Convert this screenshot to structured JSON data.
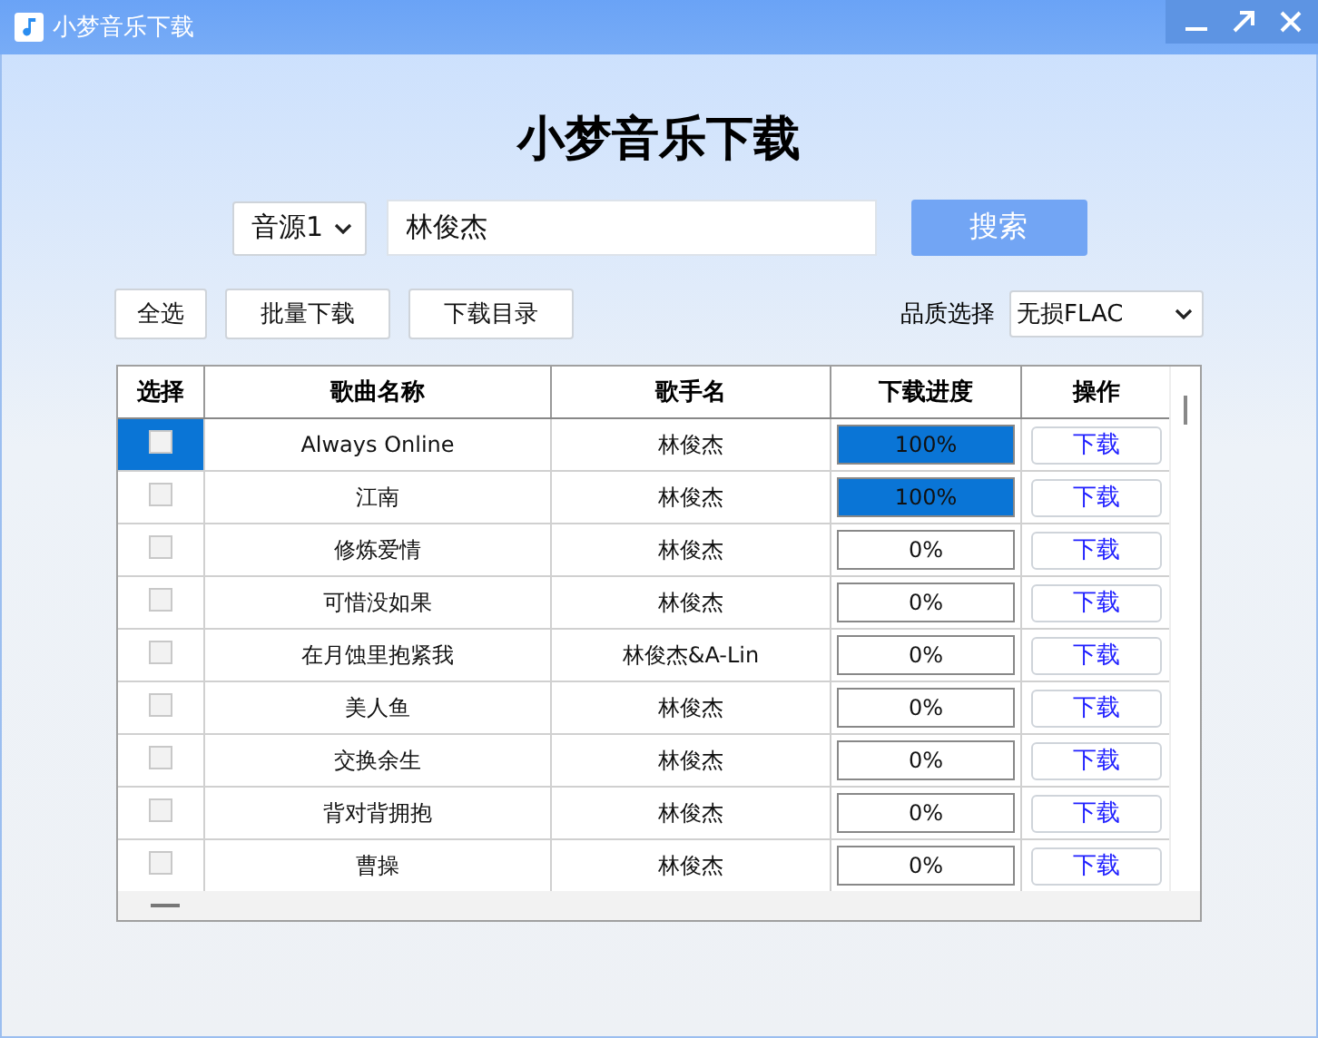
{
  "window": {
    "title": "小梦音乐下载"
  },
  "heading": "小梦音乐下载",
  "search": {
    "source": "音源1",
    "value": "林俊杰",
    "button": "搜索"
  },
  "toolbar": {
    "buttons": [
      "全选",
      "批量下载",
      "下载目录"
    ],
    "quality_label": "品质选择",
    "quality": "无损FLAC"
  },
  "table": {
    "columns": [
      "选择",
      "歌曲名称",
      "歌手名",
      "下载进度",
      "操作"
    ],
    "rows": [
      {
        "selected": true,
        "checked": false,
        "song": "Always Online",
        "artist": "林俊杰",
        "level": 1,
        "progress": "100%",
        "action": "下载"
      },
      {
        "selected": false,
        "checked": false,
        "song": "江南",
        "artist": "林俊杰",
        "level": 1,
        "progress": "100%",
        "action": "下载"
      },
      {
        "selected": false,
        "checked": false,
        "song": "修炼爱情",
        "artist": "林俊杰",
        "level": 0,
        "progress": "0%",
        "action": "下载"
      },
      {
        "selected": false,
        "checked": false,
        "song": "可惜没如果",
        "artist": "林俊杰",
        "level": 0,
        "progress": "0%",
        "action": "下载"
      },
      {
        "selected": false,
        "checked": false,
        "song": "在月蚀里抱紧我",
        "artist": "林俊杰&A-Lin",
        "level": 0,
        "progress": "0%",
        "action": "下载"
      },
      {
        "selected": false,
        "checked": false,
        "song": "美人鱼",
        "artist": "林俊杰",
        "level": 0,
        "progress": "0%",
        "action": "下载"
      },
      {
        "selected": false,
        "checked": false,
        "song": "交换余生",
        "artist": "林俊杰",
        "level": 0,
        "progress": "0%",
        "action": "下载"
      },
      {
        "selected": false,
        "checked": false,
        "song": "背对背拥抱",
        "artist": "林俊杰",
        "level": 0,
        "progress": "0%",
        "action": "下载"
      },
      {
        "selected": false,
        "checked": false,
        "song": "曹操",
        "artist": "林俊杰",
        "level": 0,
        "progress": "0%",
        "action": "下载"
      }
    ]
  }
}
